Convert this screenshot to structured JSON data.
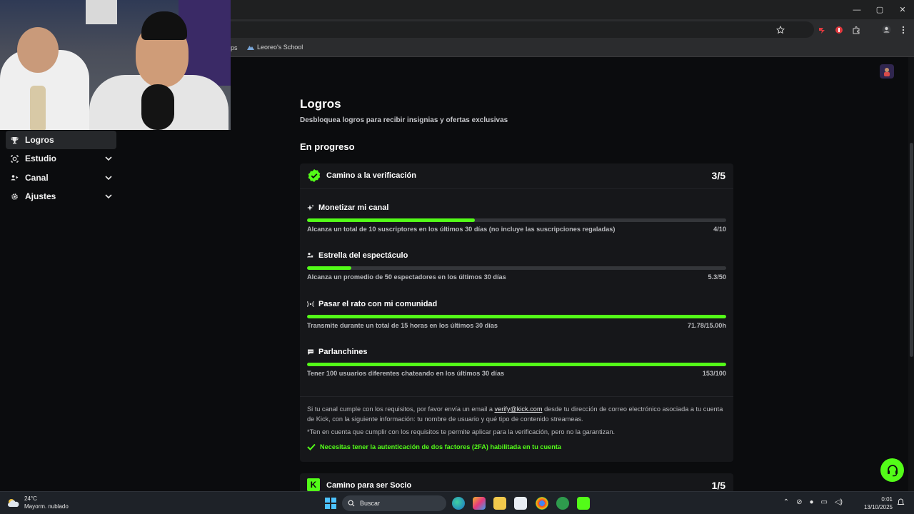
{
  "browser": {
    "window_controls": {
      "minimize": "—",
      "maximize": "▢",
      "close": "✕"
    },
    "bookmark_cut_label": "ps",
    "bookmark_label": "Leoreo's School"
  },
  "sidebar": {
    "items": [
      {
        "label": "Logros",
        "active": true,
        "has_chevron": false,
        "icon": "trophy-icon"
      },
      {
        "label": "Estudio",
        "active": false,
        "has_chevron": true,
        "icon": "studio-icon"
      },
      {
        "label": "Canal",
        "active": false,
        "has_chevron": true,
        "icon": "channel-icon"
      },
      {
        "label": "Ajustes",
        "active": false,
        "has_chevron": true,
        "icon": "gear-icon"
      }
    ]
  },
  "page": {
    "title": "Logros",
    "subtitle": "Desbloquea logros para recibir insignias y ofertas exclusivas",
    "section_title": "En progreso"
  },
  "verification_card": {
    "title": "Camino a la verificación",
    "count": "3/5",
    "achievements": [
      {
        "title": "Monetizar mi canal",
        "icon": "sparkle-icon",
        "description": "Alcanza un total de 10 suscriptores en los últimos 30 días (no incluye las suscripciones regaladas)",
        "value": "4/10",
        "progress": 0.4
      },
      {
        "title": "Estrella del espectáculo",
        "icon": "viewers-icon",
        "description": "Alcanza un promedio de 50 espectadores en los últimos 30 días",
        "value": "5.3/50",
        "progress": 0.106
      },
      {
        "title": "Pasar el rato con mi comunidad",
        "icon": "broadcast-icon",
        "description": "Transmite durante un total de 15 horas en los últimos 30 días",
        "value": "71.78/15.00h",
        "progress": 1.0
      },
      {
        "title": "Parlanchines",
        "icon": "chat-icon",
        "description": "Tener 100 usuarios diferentes chateando en los últimos 30 días",
        "value": "153/100",
        "progress": 1.0
      }
    ],
    "info_before_link": "Si tu canal cumple con los requisitos, por favor envía un email a ",
    "info_link": "verify@kick.com",
    "info_after_link": " desde tu dirección de correo electrónico asociada a tu cuenta de Kick, con la siguiente información: tu nombre de usuario y qué tipo de contenido streameas.",
    "info_note": "*Ten en cuenta que cumplir con los requisitos te permite aplicar para la verificación, pero no la garantizan.",
    "requirement": "Necesitas tener la autenticación de dos factores (2FA) habilitada en tu cuenta"
  },
  "partner_card": {
    "title": "Camino para ser Socio",
    "count": "1/5"
  },
  "taskbar": {
    "temperature": "24°C",
    "weather": "Mayorm. nublado",
    "search_placeholder": "Buscar",
    "time": "0:01",
    "date": "13/10/2025"
  },
  "colors": {
    "accent": "#53fc18",
    "card_bg": "#16171a",
    "page_bg": "#0b0c0e"
  }
}
